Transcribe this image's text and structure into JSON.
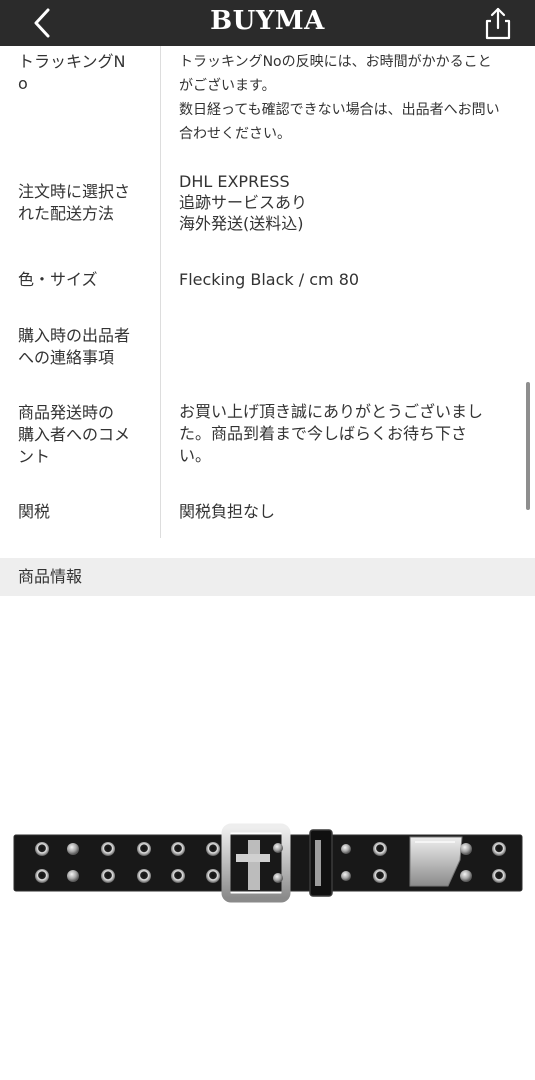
{
  "header": {
    "logo": "BUYMA",
    "back_icon": "chevron-left-icon",
    "share_icon": "share-icon"
  },
  "details": {
    "tracking": {
      "label_lines": [
        "トラッキングN",
        "o"
      ],
      "value_lines": [
        "トラッキングNoの反映には、お時間がかかること",
        "がございます。",
        "数日経っても確認できない場合は、出品者へお問い",
        "合わせください。"
      ]
    },
    "shipping_method": {
      "label_lines": [
        "注文時に選択さ",
        "れた配送方法"
      ],
      "value_lines": [
        "DHL EXPRESS",
        "追跡サービスあり",
        "海外発送(送料込)"
      ]
    },
    "color_size": {
      "label_lines": [
        "色・サイズ"
      ],
      "value_lines": [
        "Flecking Black / cm 80"
      ]
    },
    "buyer_note": {
      "label_lines": [
        "購入時の出品者",
        "への連絡事項"
      ],
      "value_lines": []
    },
    "seller_comment": {
      "label_lines": [
        "商品発送時の",
        "購入者へのコメ",
        "ント"
      ],
      "value_lines": [
        "お買い上げ頂き誠にありがとうございまし",
        "た。商品到着まで今しばらくお待ち下さ",
        "い。"
      ]
    },
    "customs": {
      "label_lines": [
        "関税"
      ],
      "value_lines": [
        "関税負担なし"
      ]
    }
  },
  "section": {
    "title": "商品情報"
  },
  "product": {
    "image_description": "black studded leather belt",
    "colors": {
      "leather": "#1a1a1a",
      "metal": "#c8c8c8"
    }
  },
  "colors": {
    "header_bg": "#2b2b2b",
    "section_bg": "#eeeeee",
    "text": "#333333",
    "divider": "#dddddd"
  }
}
